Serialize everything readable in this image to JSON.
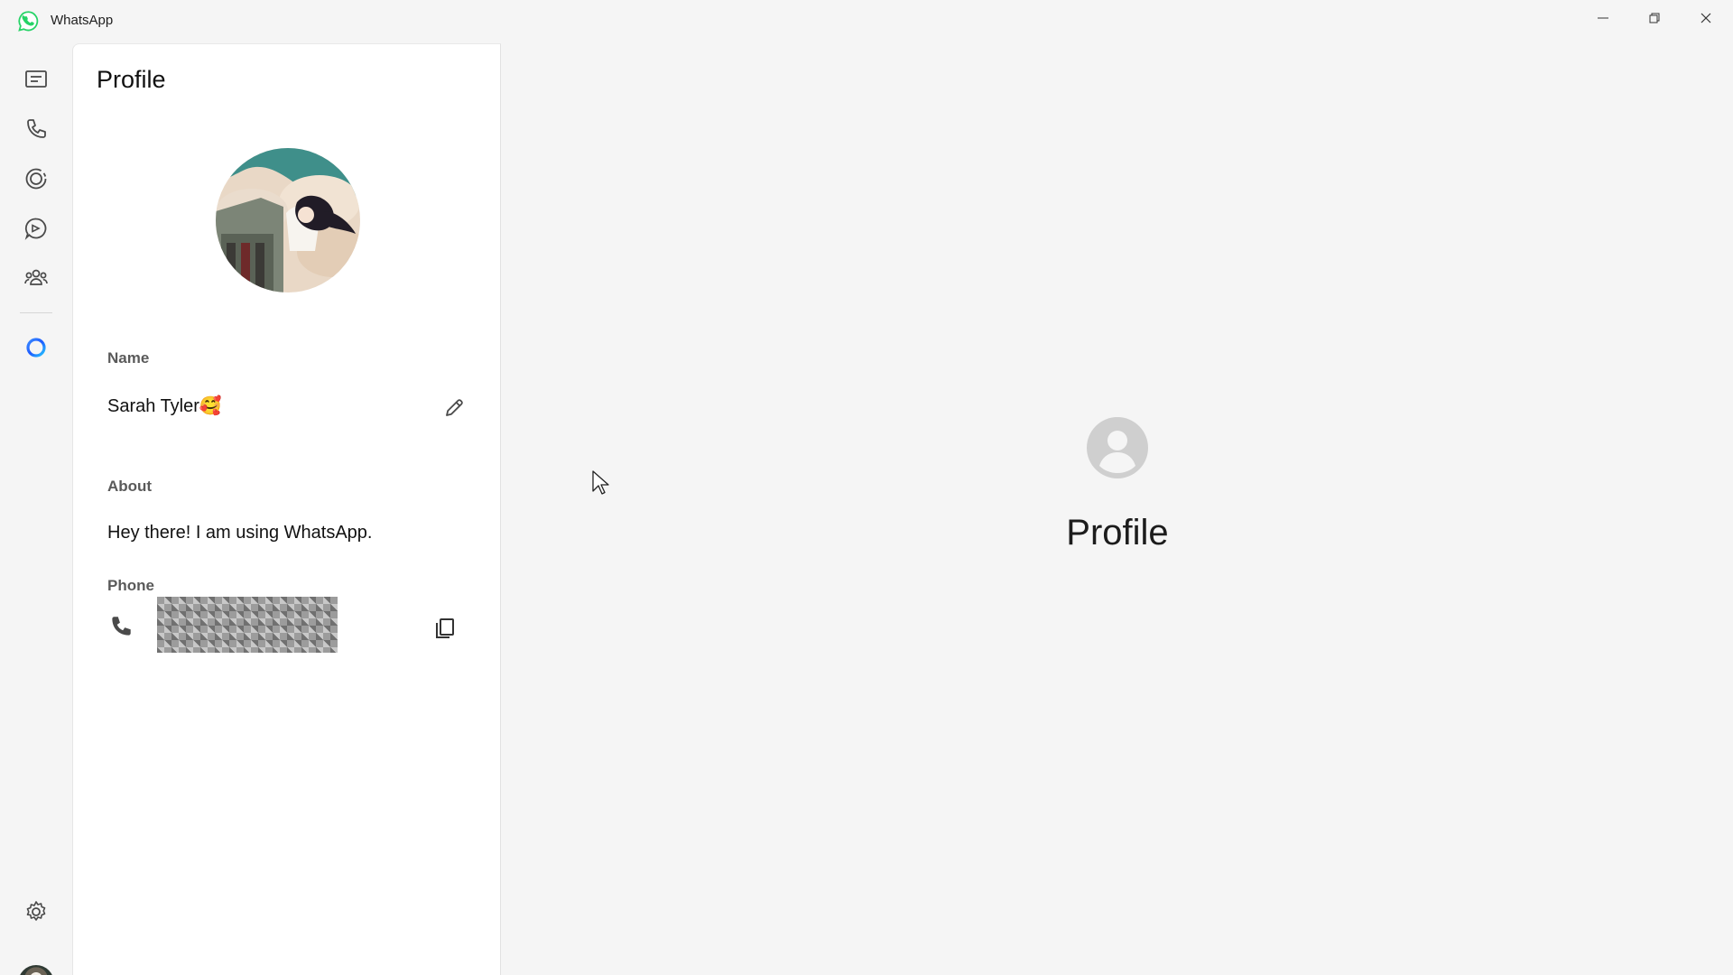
{
  "window": {
    "app_title": "WhatsApp",
    "logo_icon": "whatsapp-logo-icon",
    "controls": [
      "minimize-icon",
      "restore-icon",
      "close-icon"
    ]
  },
  "rail": {
    "items": [
      {
        "name": "chats",
        "icon": "chats-icon"
      },
      {
        "name": "calls",
        "icon": "phone-icon"
      },
      {
        "name": "status",
        "icon": "status-icon"
      },
      {
        "name": "channels",
        "icon": "channels-icon"
      },
      {
        "name": "communities",
        "icon": "communities-icon"
      },
      {
        "name": "meta-ai",
        "icon": "meta-ai-icon"
      }
    ],
    "bottom": [
      {
        "name": "settings",
        "icon": "gear-icon"
      },
      {
        "name": "profile",
        "icon": "avatar"
      }
    ]
  },
  "profile_panel": {
    "title": "Profile",
    "name_label": "Name",
    "name_value": "Sarah Tyler🥰",
    "about_label": "About",
    "about_value": "Hey there! I am using WhatsApp.",
    "phone_label": "Phone"
  },
  "main": {
    "placeholder_icon": "user-circle-icon",
    "placeholder_title": "Profile"
  },
  "colors": {
    "accent": "#25d366",
    "panel_bg": "#ffffff",
    "app_bg": "#f5f5f5",
    "meta_ai_blue": "#1e6bff"
  }
}
